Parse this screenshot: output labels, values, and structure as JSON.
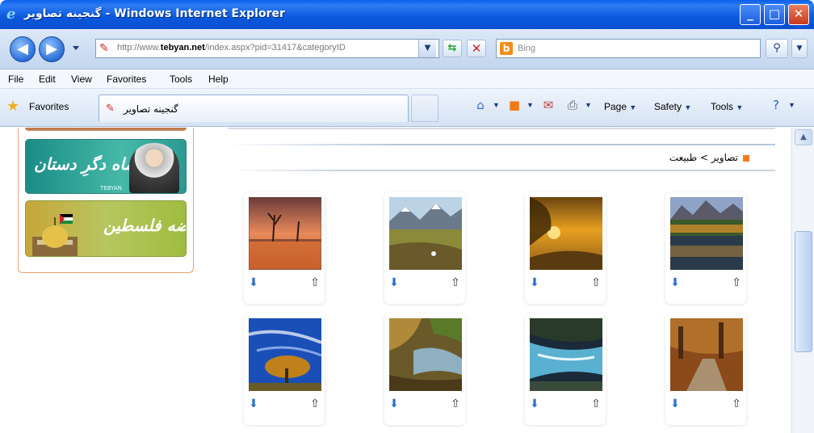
{
  "window": {
    "title": "گنجینه تصاویر - Windows Internet Explorer",
    "minimize": "_",
    "maximize": "□",
    "close": "✕"
  },
  "address": {
    "url_prefix": "http://www.",
    "url_domain": "tebyan.net",
    "url_rest": "/index.aspx?pid=31417&categoryID",
    "search_placeholder": "Bing"
  },
  "menu": {
    "items": [
      "File",
      "Edit",
      "View",
      "Favorites",
      "Tools",
      "Help"
    ]
  },
  "favbar": {
    "favorites_label": "Favorites",
    "tab_title": "گنجینه تصاویر",
    "page_label": "Page",
    "safety_label": "Safety",
    "tools_label": "Tools"
  },
  "content": {
    "breadcrumb": "تصاویر > طبیعت",
    "banner1_text": "ماه دگرِ دستان",
    "banner1_small": "TEBYAN",
    "banner2_text": "انتفاضه فلسطین"
  },
  "icons": {
    "download": "download-icon",
    "send": "send-icon"
  },
  "thumbnails": [
    {
      "scene": "misty-lake-sunset"
    },
    {
      "scene": "mountain-meadow"
    },
    {
      "scene": "golden-sunset-field"
    },
    {
      "scene": "autumn-lake-mountains"
    },
    {
      "scene": "blue-sky-autumn-tree"
    },
    {
      "scene": "river-canyon-autumn"
    },
    {
      "scene": "rushing-river"
    },
    {
      "scene": "autumn-forest-path"
    }
  ]
}
